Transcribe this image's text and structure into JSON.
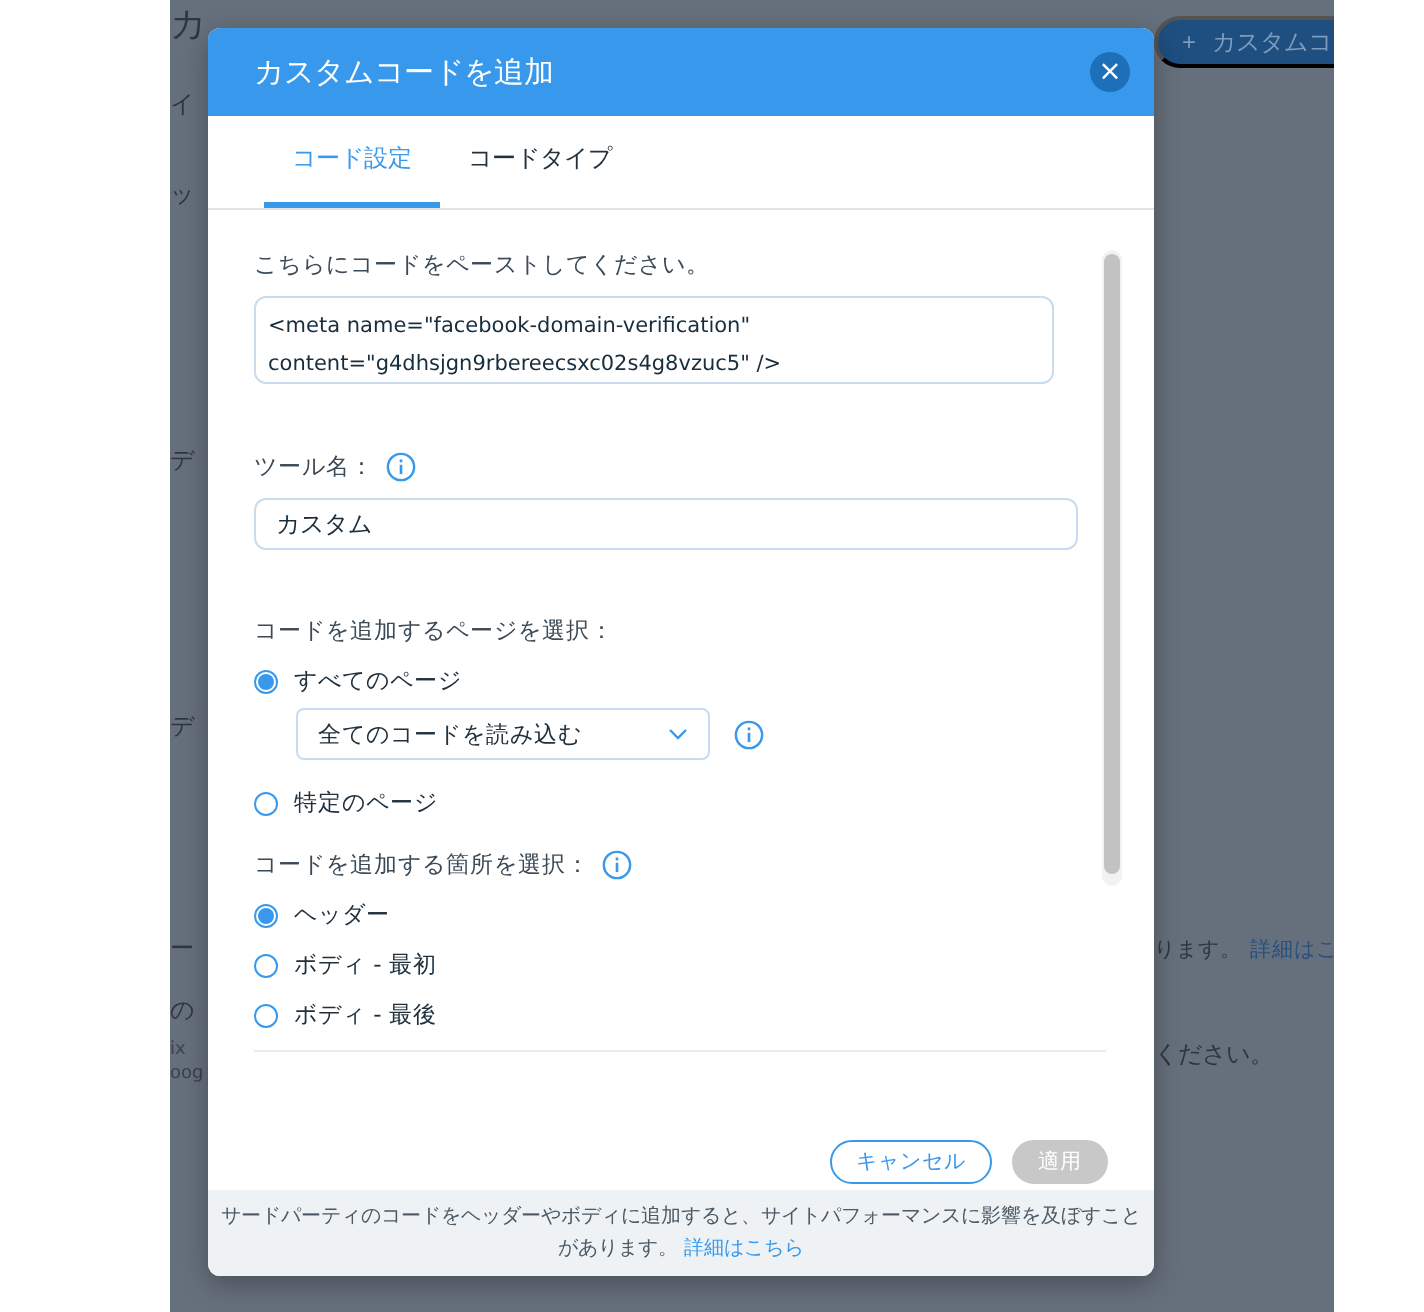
{
  "background": {
    "left_fragments": [
      {
        "text": "カ",
        "kind": "title"
      },
      {
        "text": "イ",
        "kind": "text"
      },
      {
        "text": "ッ",
        "kind": "text"
      },
      {
        "text": "デ",
        "kind": "text"
      },
      {
        "text": "デ",
        "kind": "text"
      },
      {
        "text": "ー",
        "kind": "text"
      },
      {
        "text": "の",
        "kind": "text"
      },
      {
        "text": "ix",
        "kind": "small"
      },
      {
        "text": "oog",
        "kind": "small"
      }
    ],
    "add_button": {
      "icon": "+",
      "label": "カスタムコ"
    },
    "notice": {
      "text": "ります。",
      "link": "詳細はこ"
    },
    "hint": "ください。"
  },
  "dialog": {
    "title": "カスタムコードを追加",
    "close": "×",
    "tabs": [
      {
        "label": "コード設定",
        "selected": true
      },
      {
        "label": "コードタイプ",
        "selected": false
      }
    ],
    "code_label": "こちらにコードをペーストしてください。",
    "code_value": "<meta name=\"facebook-domain-verification\" content=\"g4dhsjgn9rbereecsxc02s4g8vzuc5\" />",
    "name_label": "ツール名：",
    "name_value": "カスタム",
    "pages_label": "コードを追加するページを選択：",
    "pages_options": [
      {
        "label": "すべてのページ",
        "selected": true,
        "dropdown": "全てのコードを読み込む"
      },
      {
        "label": "特定のページ",
        "selected": false
      }
    ],
    "place_label": "コードを追加する箇所を選択：",
    "place_options": [
      {
        "label": "ヘッダー",
        "selected": true
      },
      {
        "label": "ボディ - 最初",
        "selected": false
      },
      {
        "label": "ボディ - 最後",
        "selected": false
      }
    ],
    "buttons": [
      {
        "label": "キャンセル",
        "disabled": false
      },
      {
        "label": "適用",
        "disabled": true
      }
    ],
    "footer": {
      "text": "サードパーティのコードをヘッダーやボディに追加すると、サイトパフォーマンスに影響を及ぼすことがあります。",
      "link": "詳細はこちら"
    }
  }
}
